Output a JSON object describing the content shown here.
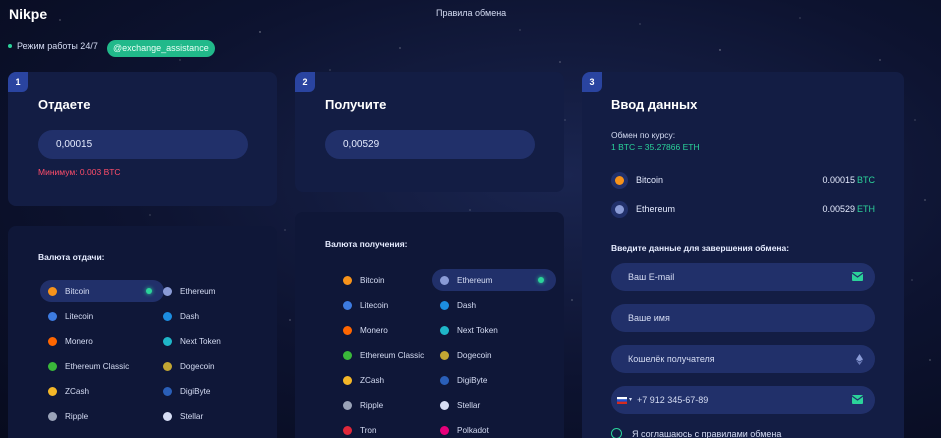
{
  "header": {
    "logo": "Nikpe",
    "nav_link": "Правила обмена"
  },
  "status": {
    "mode_text": "Режим работы 24/7",
    "telegram": "@exchange_assistance"
  },
  "give": {
    "step": "1",
    "title": "Отдаете",
    "amount": "0,00015",
    "minimum": "Минимум: 0.003 BTC",
    "list_title": "Валюта отдачи:",
    "coins": [
      {
        "label": "Bitcoin",
        "color": "#f7931a"
      },
      {
        "label": "Ethereum",
        "color": "#8a9bd6"
      },
      {
        "label": "Litecoin",
        "color": "#3d7be0"
      },
      {
        "label": "Dash",
        "color": "#1c8de0"
      },
      {
        "label": "Monero",
        "color": "#ff6600"
      },
      {
        "label": "Next Token",
        "color": "#1fb6c8"
      },
      {
        "label": "Ethereum Classic",
        "color": "#3ab83a"
      },
      {
        "label": "Dogecoin",
        "color": "#c2a633"
      },
      {
        "label": "ZCash",
        "color": "#f4b728"
      },
      {
        "label": "DigiByte",
        "color": "#2a5fb8"
      },
      {
        "label": "Ripple",
        "color": "#9aa3b8"
      },
      {
        "label": "Stellar",
        "color": "#d6ddf4"
      }
    ],
    "selected": "Bitcoin"
  },
  "receive": {
    "step": "2",
    "title": "Получите",
    "amount": "0,00529",
    "list_title": "Валюта получения:",
    "coins": [
      {
        "label": "Bitcoin",
        "color": "#f7931a"
      },
      {
        "label": "Ethereum",
        "color": "#8a9bd6"
      },
      {
        "label": "Litecoin",
        "color": "#3d7be0"
      },
      {
        "label": "Dash",
        "color": "#1c8de0"
      },
      {
        "label": "Monero",
        "color": "#ff6600"
      },
      {
        "label": "Next Token",
        "color": "#1fb6c8"
      },
      {
        "label": "Ethereum Classic",
        "color": "#3ab83a"
      },
      {
        "label": "Dogecoin",
        "color": "#c2a633"
      },
      {
        "label": "ZCash",
        "color": "#f4b728"
      },
      {
        "label": "DigiByte",
        "color": "#2a5fb8"
      },
      {
        "label": "Ripple",
        "color": "#9aa3b8"
      },
      {
        "label": "Stellar",
        "color": "#d6ddf4"
      },
      {
        "label": "Tron",
        "color": "#e0283a"
      },
      {
        "label": "Polkadot",
        "color": "#e6007a"
      }
    ],
    "selected": "Ethereum"
  },
  "details": {
    "step": "3",
    "title": "Ввод данных",
    "rate_label": "Обмен по курсу:",
    "rate_value": "1 BTC = 35.27866 ETH",
    "summary": [
      {
        "coin": "Bitcoin",
        "amount": "0.00015",
        "currency": "BTC",
        "color": "#f7931a"
      },
      {
        "coin": "Ethereum",
        "amount": "0.00529",
        "currency": "ETH",
        "color": "#8a9bd6"
      }
    ],
    "form_title": "Введите данные для завершения обмена:",
    "email_placeholder": "Ваш E-mail",
    "name_placeholder": "Ваше имя",
    "wallet_placeholder": "Кошелёк получателя",
    "phone_placeholder": "+7  912 345-67-89",
    "agree_text": "Я соглашаюсь с правилами обмена"
  },
  "colors": {
    "accent": "#2bd39a",
    "card": "#131d44",
    "field": "#21306a",
    "badge": "#2a44a0",
    "error": "#ff4d6a"
  }
}
